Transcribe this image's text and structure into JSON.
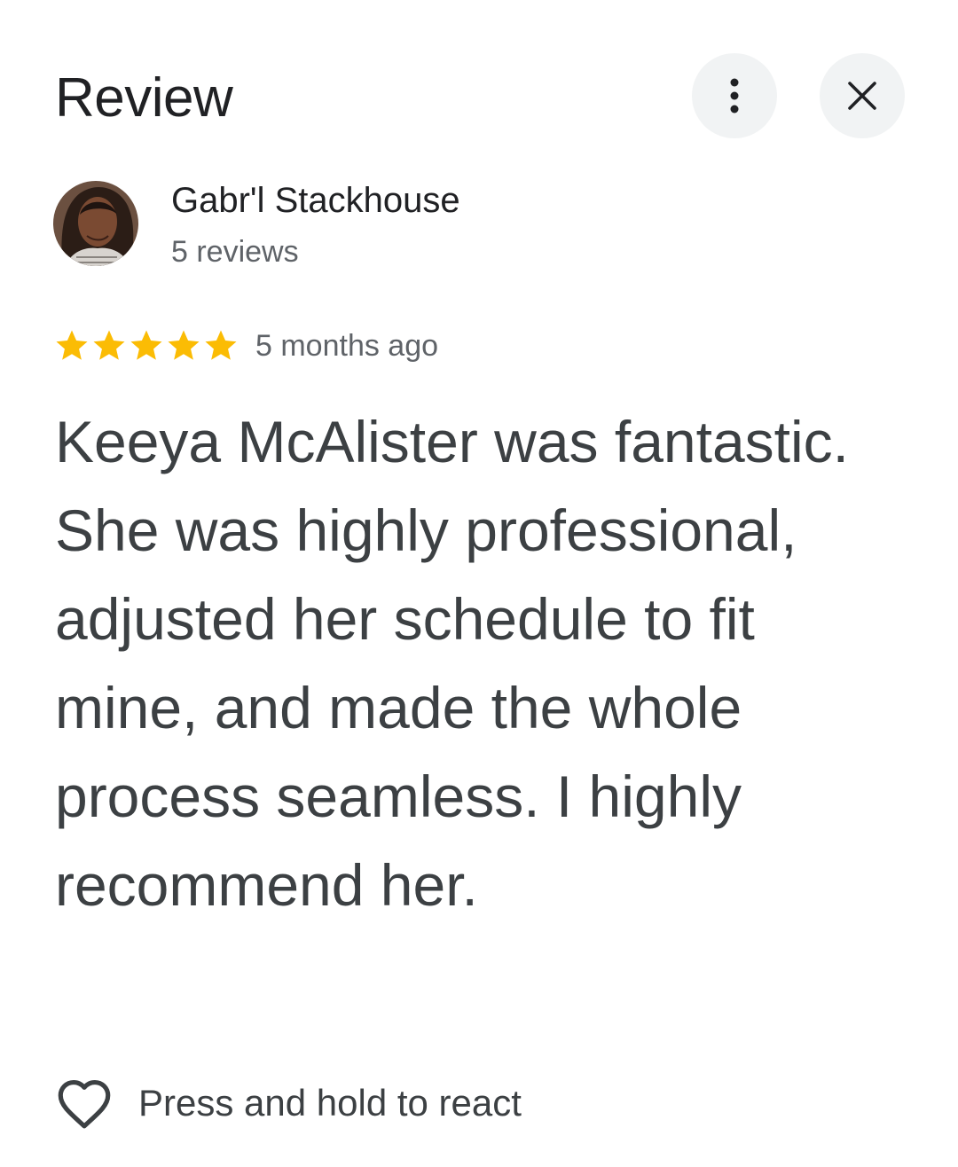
{
  "header": {
    "title": "Review",
    "more_icon": "more-vert-icon",
    "close_icon": "close-icon"
  },
  "author": {
    "name": "Gabr'l Stackhouse",
    "review_count": "5 reviews",
    "avatar": "profile-photo"
  },
  "review": {
    "rating": 5,
    "rating_max": 5,
    "time": "5 months ago",
    "text": "Keeya McAlister was fantastic. She was highly professional, adjusted her schedule to fit mine, and made the whole process seamless. I highly recommend her."
  },
  "reaction": {
    "label": "Press and hold to react",
    "icon": "heart-outline-icon"
  },
  "colors": {
    "star": "#fbbc04",
    "button_bg": "#f1f3f4",
    "primary_text": "#202124",
    "secondary_text": "#5f6368",
    "body_text": "#3c4043"
  }
}
